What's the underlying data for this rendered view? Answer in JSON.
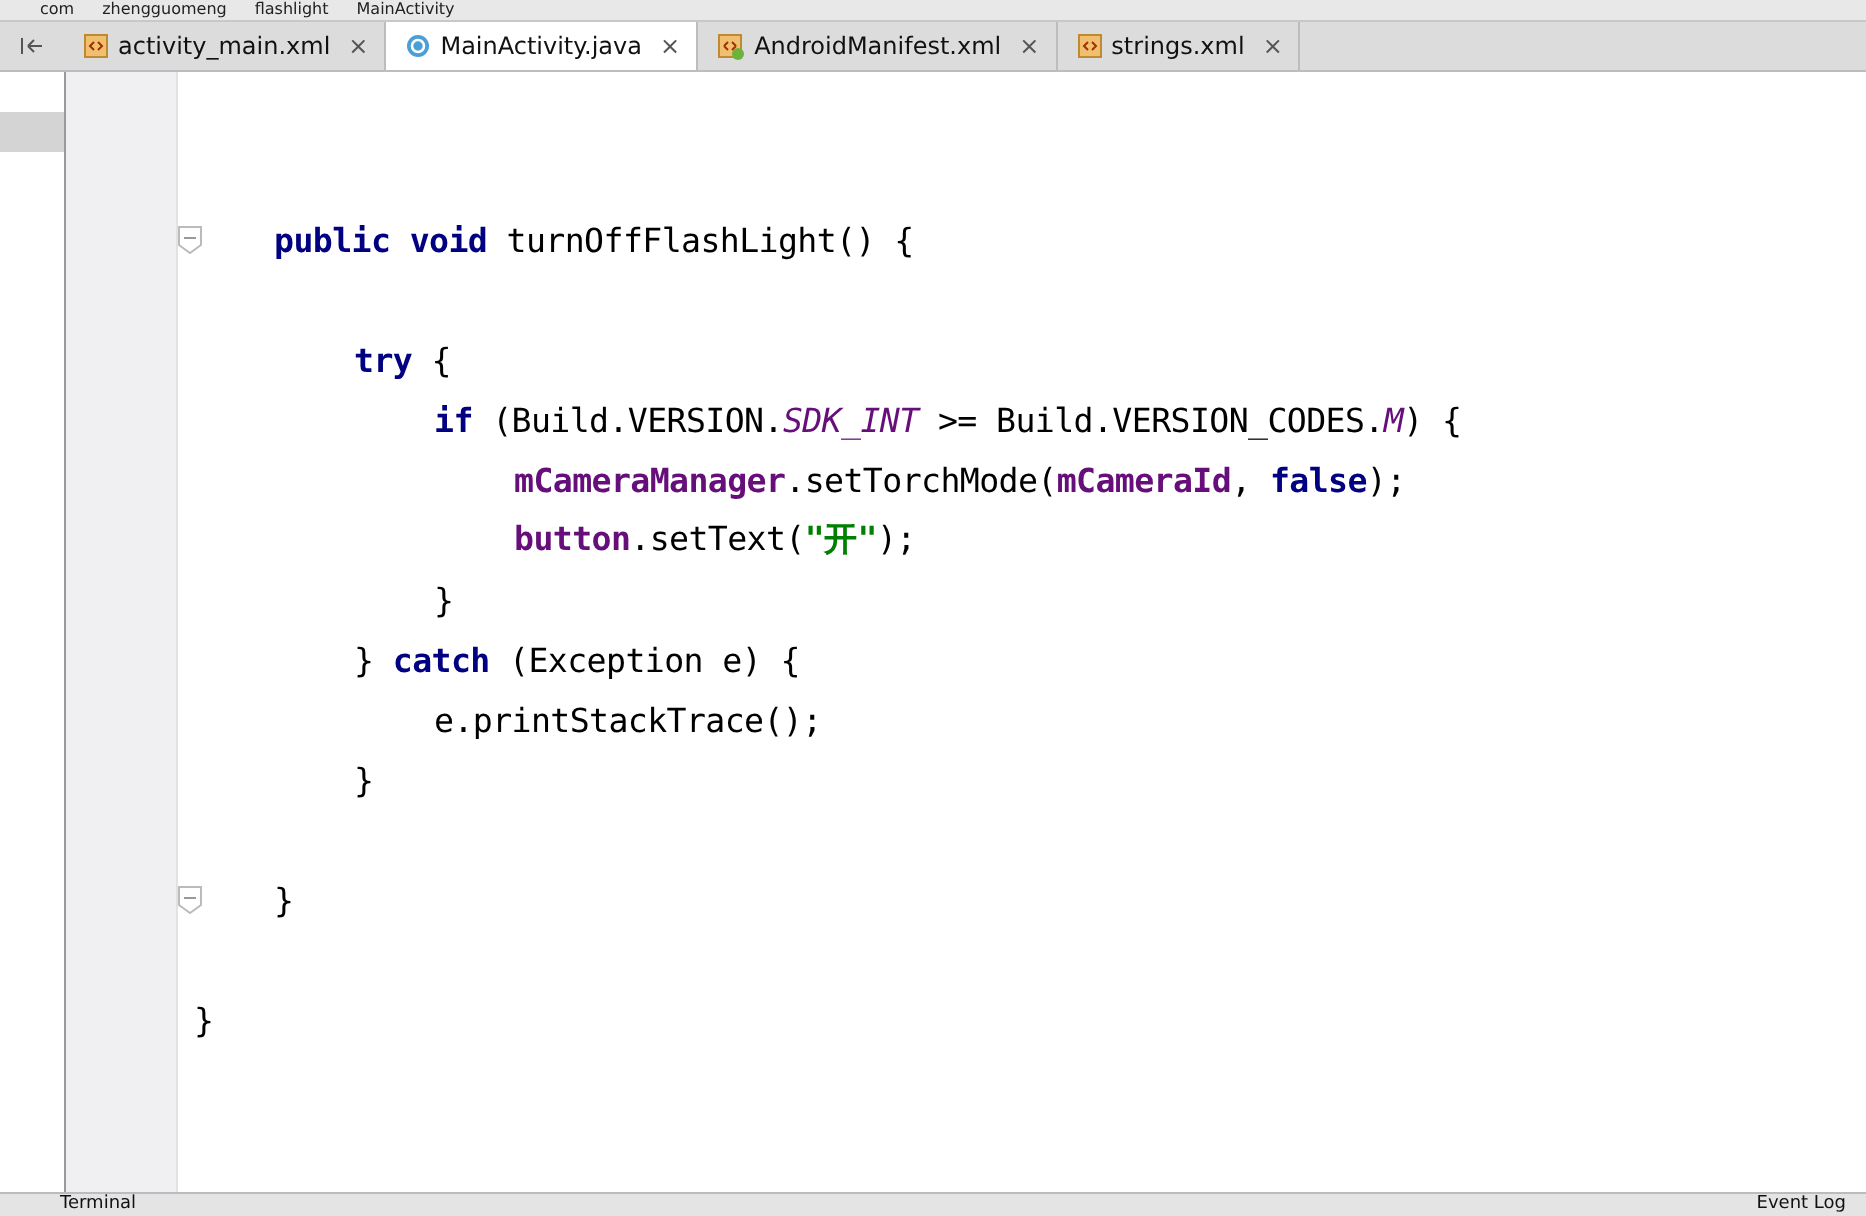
{
  "breadcrumb": [
    "com",
    "zhengguomeng",
    "flashlight",
    "MainActivity"
  ],
  "tabs": [
    {
      "label": "activity_main.xml",
      "kind": "xml",
      "selected": false,
      "close": "×"
    },
    {
      "label": "MainActivity.java",
      "kind": "class",
      "selected": true,
      "close": "×"
    },
    {
      "label": "AndroidManifest.xml",
      "kind": "manifest",
      "selected": false,
      "close": "×"
    },
    {
      "label": "strings.xml",
      "kind": "xml",
      "selected": false,
      "close": "×"
    }
  ],
  "code": [
    {
      "kind": "block",
      "children": [
        {
          "kind": "blank"
        },
        {
          "kind": "blank"
        },
        {
          "kind": "line",
          "fold": true,
          "tokens": [
            {
              "text": "public void ",
              "kind": "keyword"
            },
            {
              "text": "turnOffFlashLight() {",
              "kind": "plain"
            }
          ],
          "children": [
            {
              "kind": "blank"
            },
            {
              "kind": "line",
              "fold": false,
              "tokens": [
                {
                  "text": "try ",
                  "kind": "keyword"
                },
                {
                  "text": "{",
                  "kind": "plain"
                }
              ],
              "children": [
                {
                  "kind": "line",
                  "fold": false,
                  "tokens": [
                    {
                      "text": "if ",
                      "kind": "keyword"
                    },
                    {
                      "text": "(Build.VERSION.",
                      "kind": "plain"
                    },
                    {
                      "text": "SDK_INT",
                      "kind": "static"
                    },
                    {
                      "text": " >= Build.VERSION_CODES.",
                      "kind": "plain"
                    },
                    {
                      "text": "M",
                      "kind": "static"
                    },
                    {
                      "text": ") {",
                      "kind": "plain"
                    }
                  ],
                  "children": [
                    {
                      "kind": "line",
                      "fold": false,
                      "tokens": [
                        {
                          "text": "mCameraManager",
                          "kind": "field"
                        },
                        {
                          "text": ".setTorchMode(",
                          "kind": "plain"
                        },
                        {
                          "text": "mCameraId",
                          "kind": "field"
                        },
                        {
                          "text": ", ",
                          "kind": "plain"
                        },
                        {
                          "text": "false",
                          "kind": "keyword"
                        },
                        {
                          "text": ");",
                          "kind": "plain"
                        }
                      ]
                    },
                    {
                      "kind": "line",
                      "fold": false,
                      "tokens": [
                        {
                          "text": "button",
                          "kind": "field"
                        },
                        {
                          "text": ".setText(",
                          "kind": "plain"
                        },
                        {
                          "text": "\"开\"",
                          "kind": "string"
                        },
                        {
                          "text": ");",
                          "kind": "plain"
                        }
                      ]
                    }
                  ]
                },
                {
                  "kind": "line",
                  "fold": false,
                  "tokens": [
                    {
                      "text": "}",
                      "kind": "plain"
                    }
                  ]
                }
              ]
            },
            {
              "kind": "line",
              "fold": false,
              "tokens": [
                {
                  "text": "} ",
                  "kind": "plain"
                },
                {
                  "text": "catch ",
                  "kind": "keyword"
                },
                {
                  "text": "(Exception e) {",
                  "kind": "plain"
                }
              ],
              "children": [
                {
                  "kind": "line",
                  "fold": false,
                  "tokens": [
                    {
                      "text": "e.printStackTrace();",
                      "kind": "plain"
                    }
                  ]
                }
              ]
            },
            {
              "kind": "line",
              "fold": false,
              "tokens": [
                {
                  "text": "}",
                  "kind": "plain"
                }
              ]
            },
            {
              "kind": "blank"
            }
          ]
        },
        {
          "kind": "line",
          "fold": true,
          "tokens": [
            {
              "text": "}",
              "kind": "plain"
            }
          ]
        },
        {
          "kind": "blank"
        }
      ]
    },
    {
      "kind": "line",
      "fold": false,
      "tokens": [
        {
          "text": "}",
          "kind": "plain"
        }
      ]
    }
  ],
  "status_bar": {
    "left": "Terminal",
    "right": "Event Log"
  }
}
